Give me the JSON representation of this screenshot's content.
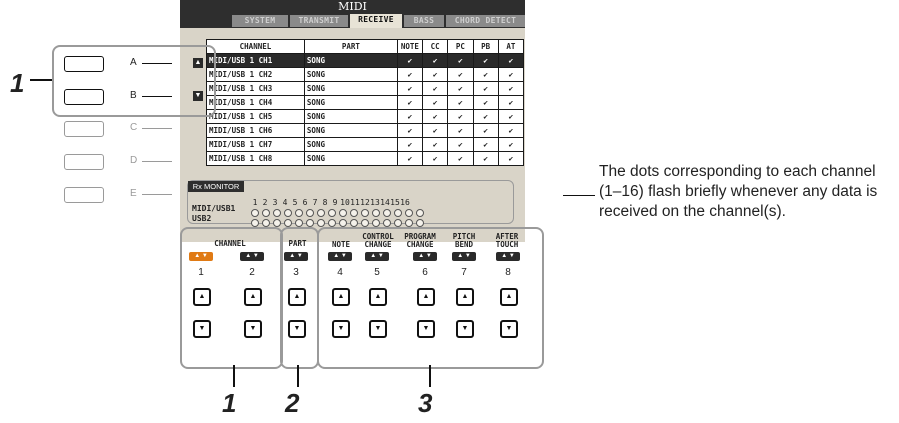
{
  "screen": {
    "title": "MIDI",
    "tabs": [
      "SYSTEM",
      "TRANSMIT",
      "RECEIVE",
      "BASS",
      "CHORD DETECT"
    ],
    "active_tab": "RECEIVE",
    "columns": [
      "CHANNEL",
      "PART",
      "NOTE",
      "CC",
      "PC",
      "PB",
      "AT"
    ],
    "rows": [
      {
        "channel": "MIDI/USB 1 CH1",
        "part": "SONG"
      },
      {
        "channel": "MIDI/USB 1 CH2",
        "part": "SONG"
      },
      {
        "channel": "MIDI/USB 1 CH3",
        "part": "SONG"
      },
      {
        "channel": "MIDI/USB 1 CH4",
        "part": "SONG"
      },
      {
        "channel": "MIDI/USB 1 CH5",
        "part": "SONG"
      },
      {
        "channel": "MIDI/USB 1 CH6",
        "part": "SONG"
      },
      {
        "channel": "MIDI/USB 1 CH7",
        "part": "SONG"
      },
      {
        "channel": "MIDI/USB 1 CH8",
        "part": "SONG"
      }
    ],
    "check_glyph": "✔",
    "monitor": {
      "label": "Rx MONITOR",
      "rows": [
        "MIDI/USB1",
        "USB2"
      ],
      "channel_numbers": [
        "1",
        "2",
        "3",
        "4",
        "5",
        "6",
        "7",
        "8",
        "9",
        "10",
        "11",
        "12",
        "13",
        "14",
        "15",
        "16"
      ]
    }
  },
  "left_panel": {
    "buttons": [
      "A",
      "B",
      "C",
      "D",
      "E"
    ],
    "callout": "1"
  },
  "bottom_panel": {
    "groups": [
      {
        "header": "CHANNEL",
        "cols": [
          "1",
          "2"
        ]
      },
      {
        "header": "PART",
        "cols": [
          "3"
        ]
      },
      {
        "header_cols": [
          "NOTE",
          "CONTROL CHANGE",
          "PROGRAM CHANGE",
          "PITCH BEND",
          "AFTER TOUCH"
        ],
        "cols": [
          "4",
          "5",
          "6",
          "7",
          "8"
        ]
      }
    ],
    "callouts": [
      "1",
      "2",
      "3"
    ],
    "up_icon": "▲",
    "down_icon": "▼"
  },
  "note": "The dots corresponding to each channel (1–16) flash briefly whenever any data is received on the channel(s)."
}
